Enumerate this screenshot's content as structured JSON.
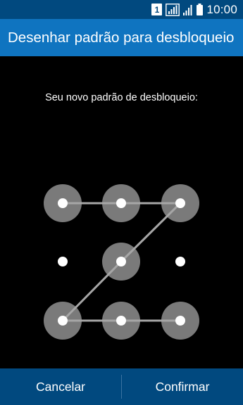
{
  "status_bar": {
    "sim_label": "1",
    "time": "10:00",
    "icons": [
      "sim-1-icon",
      "signal-roaming-icon",
      "signal-icon",
      "battery-icon"
    ]
  },
  "app_bar": {
    "title": "Desenhar padrão para desbloqueio"
  },
  "content": {
    "instruction": "Seu novo padrão de desbloqueio:"
  },
  "pattern": {
    "selected_sequence": [
      1,
      2,
      3,
      5,
      7,
      8,
      9
    ],
    "colors": {
      "selected_ring": "#7a7a7a",
      "dot": "#ffffff",
      "line": "#a6a6a6"
    }
  },
  "bottom_bar": {
    "cancel_label": "Cancelar",
    "confirm_label": "Confirmar"
  },
  "colors": {
    "status_bar": "#01497f",
    "app_bar": "#0f74c0",
    "bottom_bar": "#01497f",
    "background": "#000000"
  }
}
